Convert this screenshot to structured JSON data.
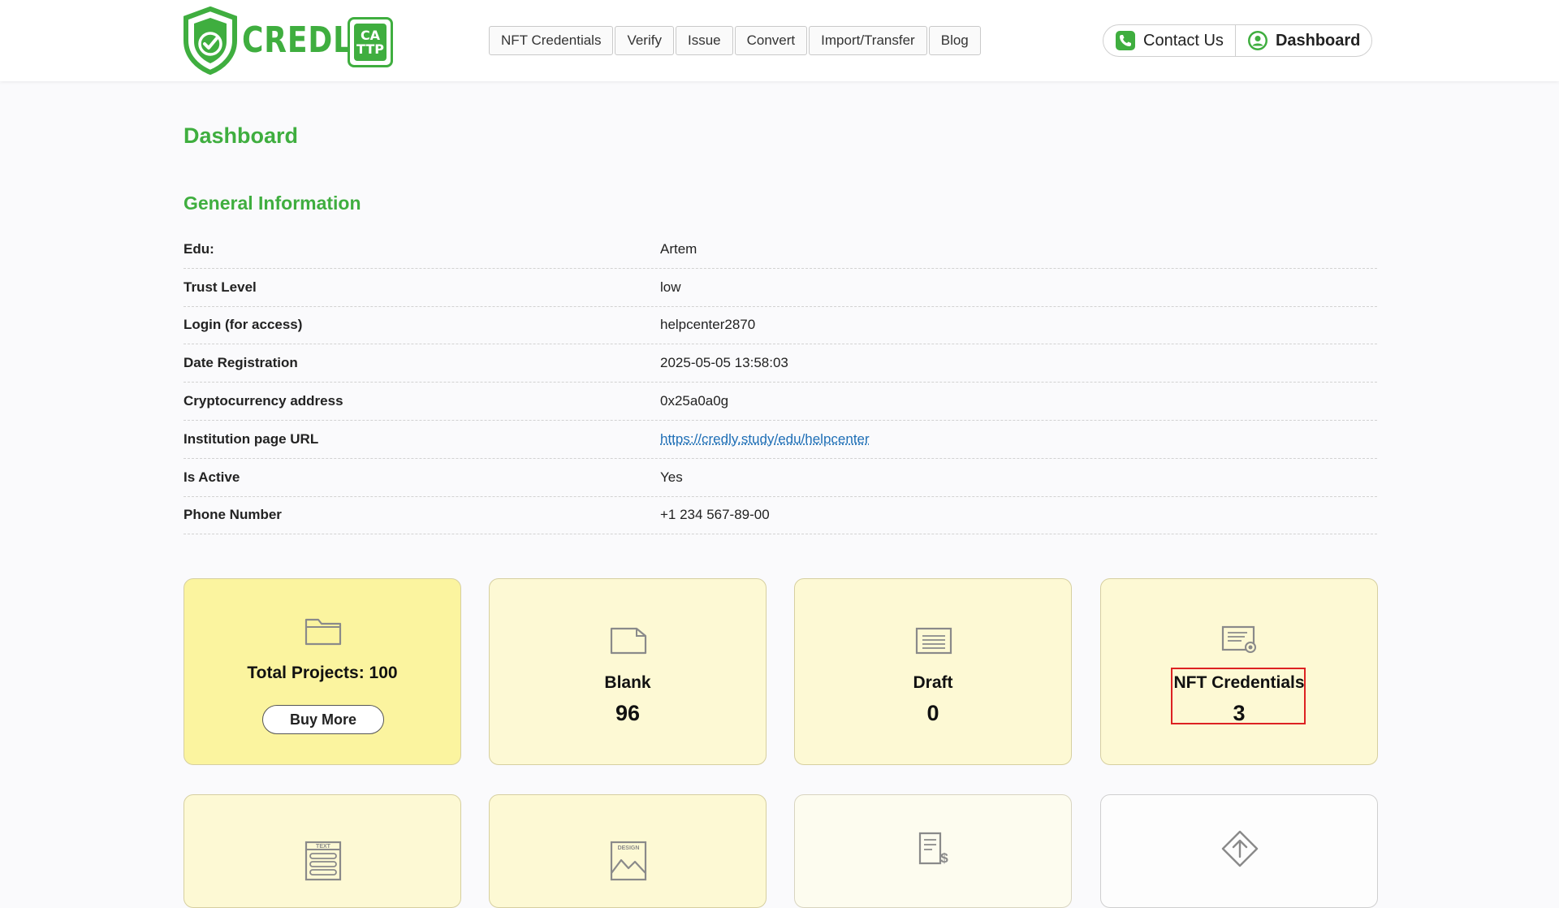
{
  "brand": {
    "name": "CREDLY",
    "badge_line1": "CA",
    "badge_line2": "TTP",
    "color": "#3fae3f"
  },
  "nav": {
    "items": [
      "NFT Credentials",
      "Verify",
      "Issue",
      "Convert",
      "Import/Transfer",
      "Blog"
    ]
  },
  "header_actions": {
    "contact_label": "Contact Us",
    "contact_icon": "phone-icon",
    "dashboard_label": "Dashboard",
    "dashboard_icon": "user-icon"
  },
  "page_title": "Dashboard",
  "general_info": {
    "title": "General Information",
    "rows": [
      {
        "label": "Edu:",
        "value": "Artem"
      },
      {
        "label": "Trust Level",
        "value": "low"
      },
      {
        "label": "Login (for access)",
        "value": "helpcenter2870"
      },
      {
        "label": "Date Registration",
        "value": "2025-05-05 13:58:03"
      },
      {
        "label": "Cryptocurrency address",
        "value": "0x25a0a0g"
      },
      {
        "label": "Institution page URL",
        "value": "https://credly.study/edu/helpcenter"
      },
      {
        "label": "Is Active",
        "value": "Yes"
      },
      {
        "label": "Phone Number",
        "value": "+1 234 567-89-00"
      }
    ]
  },
  "cards": {
    "total_projects": {
      "label": "Total Projects: 100",
      "button": "Buy More",
      "icon": "folder-icon"
    },
    "blank": {
      "label": "Blank",
      "count": "96",
      "icon": "blank-folder-icon"
    },
    "draft": {
      "label": "Draft",
      "count": "0",
      "icon": "draft-document-icon"
    },
    "nft_credentials": {
      "label": "NFT Credentials",
      "count": "3",
      "icon": "certificate-icon"
    },
    "row2_icons": [
      "text-template-icon",
      "design-template-icon",
      "invoice-icon",
      "upload-diamond-icon"
    ],
    "text_icon_label": "TEXT",
    "design_icon_label": "DESIGN"
  },
  "colors": {
    "accent_green": "#3fae3f",
    "card_yellow": "#fdf9d4",
    "card_highlight": "#fbf49f",
    "link_blue": "#1f6fb6",
    "highlight_border": "#dd2222"
  }
}
